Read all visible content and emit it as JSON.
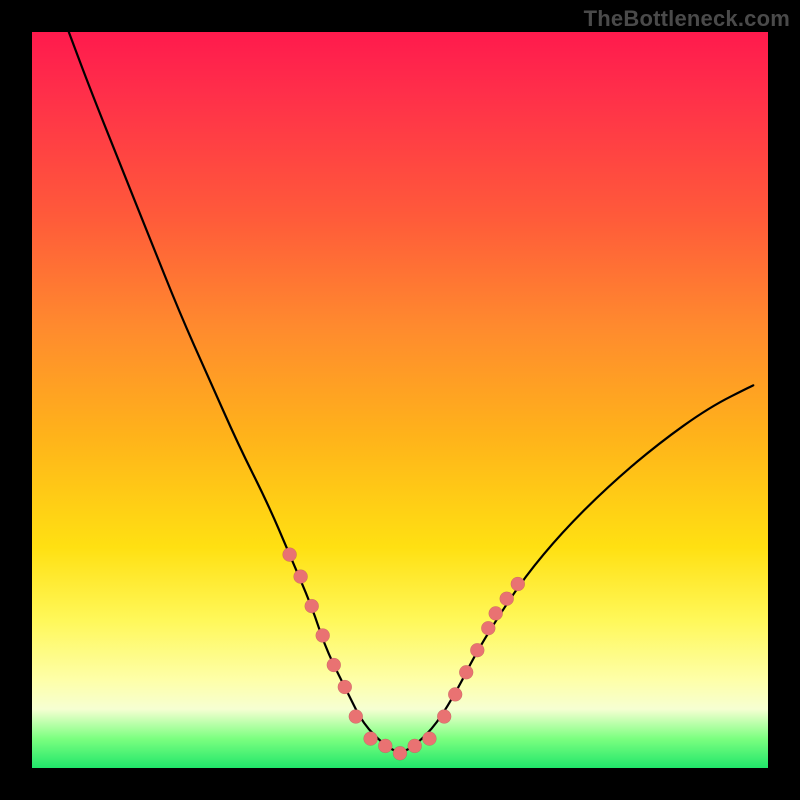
{
  "watermark": "TheBottleneck.com",
  "colors": {
    "background": "#000000",
    "gradient_top": "#ff1a4d",
    "gradient_bottom": "#20e66a",
    "curve": "#000000",
    "dot": "#e97272"
  },
  "chart_data": {
    "type": "line",
    "title": "",
    "xlabel": "",
    "ylabel": "",
    "xlim": [
      0,
      100
    ],
    "ylim": [
      0,
      100
    ],
    "grid": false,
    "legend": false,
    "note": "Axes are unlabeled in the source image; coordinates are normalized 0–100. y=0 is bottom (green), y=100 is top (red). The curve is a V-shaped bottleneck profile with a flat trough near y≈2 around x≈45–55, rising sharply to y≈100 on the left edge and to y≈52 on the right edge.",
    "series": [
      {
        "name": "bottleneck-curve",
        "x": [
          5,
          8,
          12,
          16,
          20,
          24,
          28,
          32,
          35,
          38,
          40,
          43,
          45,
          48,
          50,
          52,
          55,
          58,
          60,
          63,
          67,
          72,
          78,
          85,
          92,
          98
        ],
        "y": [
          100,
          92,
          82,
          72,
          62,
          53,
          44,
          36,
          29,
          22,
          16,
          10,
          6,
          3,
          2,
          3,
          6,
          11,
          15,
          20,
          26,
          32,
          38,
          44,
          49,
          52
        ]
      }
    ],
    "markers": {
      "name": "highlight-dots",
      "note": "Salmon-colored dots clustered on the lower flanks and trough of the curve.",
      "points": [
        {
          "x": 35,
          "y": 29
        },
        {
          "x": 36.5,
          "y": 26
        },
        {
          "x": 38,
          "y": 22
        },
        {
          "x": 39.5,
          "y": 18
        },
        {
          "x": 41,
          "y": 14
        },
        {
          "x": 42.5,
          "y": 11
        },
        {
          "x": 44,
          "y": 7
        },
        {
          "x": 46,
          "y": 4
        },
        {
          "x": 48,
          "y": 3
        },
        {
          "x": 50,
          "y": 2
        },
        {
          "x": 52,
          "y": 3
        },
        {
          "x": 54,
          "y": 4
        },
        {
          "x": 56,
          "y": 7
        },
        {
          "x": 57.5,
          "y": 10
        },
        {
          "x": 59,
          "y": 13
        },
        {
          "x": 60.5,
          "y": 16
        },
        {
          "x": 62,
          "y": 19
        },
        {
          "x": 63,
          "y": 21
        },
        {
          "x": 64.5,
          "y": 23
        },
        {
          "x": 66,
          "y": 25
        }
      ]
    }
  }
}
